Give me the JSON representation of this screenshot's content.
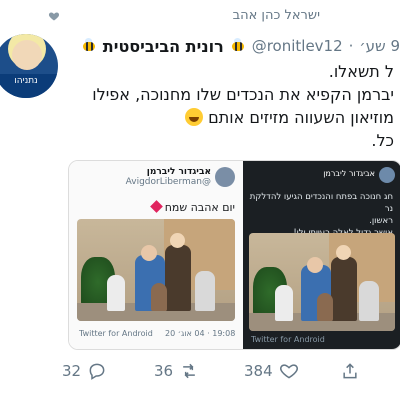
{
  "retweet_bar": {
    "label": "ישראל כהן אהב"
  },
  "tweet": {
    "author_name": "רונית הביביסטית",
    "handle": "@ronitlev12",
    "time": "9 שע׳",
    "lines": [
      "ל תשאלו.",
      "יברמן הקפיא את הנכדים שלו מחנוכה, אפילו",
      "מוזיאון השעווה מזיזים אותם",
      "כל."
    ],
    "avatar_caption": "נתניהו"
  },
  "embedded_left": {
    "author_name": "אביגדור ליברמן",
    "handle": "@AvigdorLiberman",
    "text": "יום אהבה שמח",
    "footer_time": "19:08 · 04 אוג׳ 20",
    "footer_source": "Twitter for Android"
  },
  "embedded_right": {
    "author_name": "אביגדור ליברמן",
    "text_lines": [
      "חג חנוכה בפתח והנכדים הגיעו להדלקת נר",
      "ראשון.",
      "אושר גדול לאלה רעייתי ולי!"
    ],
    "footer_source": "Twitter for Android"
  },
  "actions": {
    "reply_count": "32",
    "retweet_count": "36",
    "like_count": "384"
  },
  "colors": {
    "muted": "#657786",
    "heart_red": "#e0245e",
    "dark_panel": "#1b1f23"
  },
  "icons": {
    "liked_heart": "heart-icon",
    "reply": "reply-icon",
    "retweet": "retweet-icon",
    "like": "like-icon",
    "share": "share-icon"
  }
}
